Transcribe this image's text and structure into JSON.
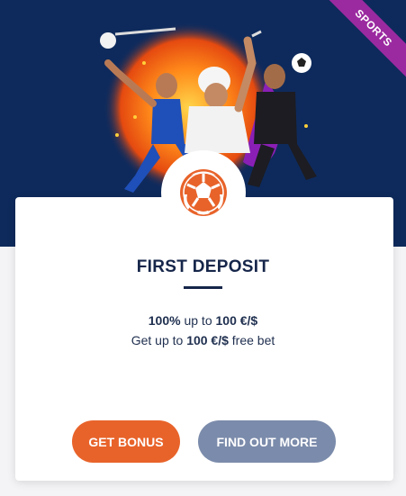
{
  "badge": {
    "label": "SPORTS"
  },
  "promo": {
    "title": "FIRST DEPOSIT",
    "line1": {
      "bold_start": "100%",
      "mid": " up to ",
      "bold_end": "100 €/$"
    },
    "line2": {
      "start": "Get up to ",
      "bold": "100 €/$",
      "end": " free bet"
    }
  },
  "buttons": {
    "bonus": "GET BONUS",
    "more": "FIND OUT MORE"
  },
  "colors": {
    "hero_bg": "#0e2a5c",
    "accent_orange": "#e8632a",
    "secondary_button": "#7b8bab",
    "ribbon": "#9b2aa0",
    "title": "#16264a"
  },
  "icons": {
    "category": "soccer-ball-icon"
  }
}
